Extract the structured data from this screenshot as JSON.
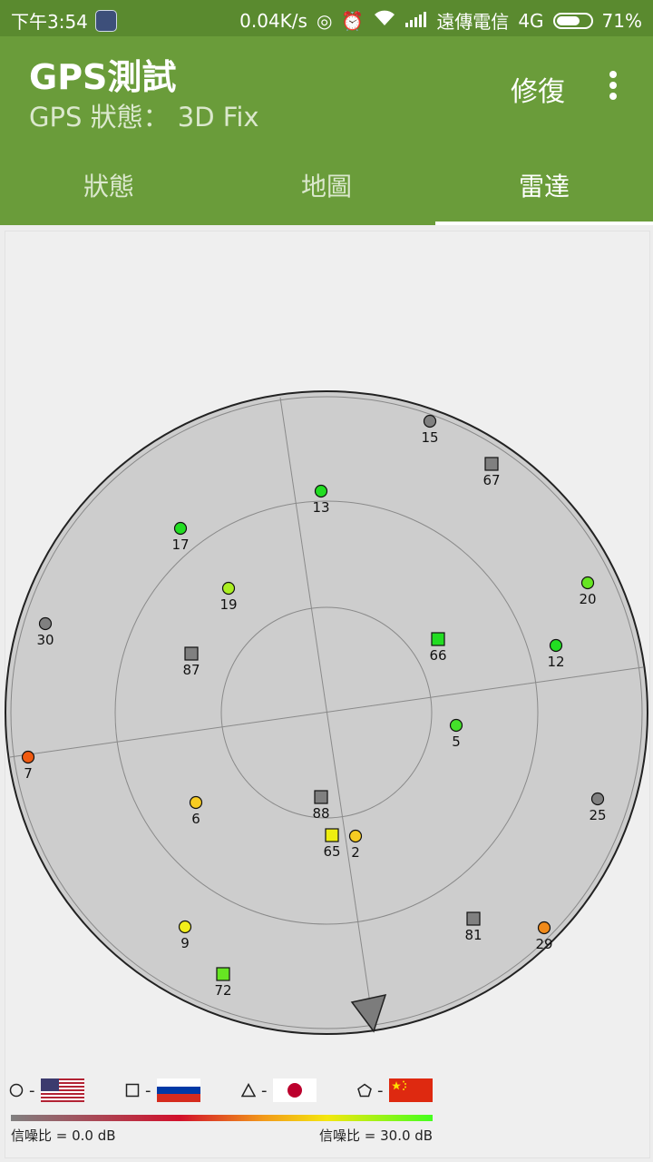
{
  "statusbar": {
    "time": "下午3:54",
    "speed": "0.04K/s",
    "carrier": "遠傳電信",
    "network": "4G",
    "battery": "71%",
    "battery_level": 0.71
  },
  "appbar": {
    "title": "GPS測試",
    "subtitle": "GPS 狀態： 3D Fix",
    "fix_button": "修復"
  },
  "tabs": [
    {
      "label": "狀態",
      "active": false
    },
    {
      "label": "地圖",
      "active": false
    },
    {
      "label": "雷達",
      "active": true
    }
  ],
  "satellites": [
    {
      "prn": "15",
      "shape": "circle",
      "color": "#808080"
    },
    {
      "prn": "67",
      "shape": "square",
      "color": "#808080"
    },
    {
      "prn": "13",
      "shape": "circle",
      "color": "#22dd22"
    },
    {
      "prn": "17",
      "shape": "circle",
      "color": "#22dd22"
    },
    {
      "prn": "20",
      "shape": "circle",
      "color": "#66e622"
    },
    {
      "prn": "19",
      "shape": "circle",
      "color": "#aaee22"
    },
    {
      "prn": "30",
      "shape": "circle",
      "color": "#808080"
    },
    {
      "prn": "66",
      "shape": "square",
      "color": "#22dd22"
    },
    {
      "prn": "12",
      "shape": "circle",
      "color": "#22dd22"
    },
    {
      "prn": "87",
      "shape": "square",
      "color": "#808080"
    },
    {
      "prn": "5",
      "shape": "circle",
      "color": "#44e02a"
    },
    {
      "prn": "7",
      "shape": "circle",
      "color": "#f05a10"
    },
    {
      "prn": "88",
      "shape": "square",
      "color": "#808080"
    },
    {
      "prn": "6",
      "shape": "circle",
      "color": "#f7cc22"
    },
    {
      "prn": "25",
      "shape": "circle",
      "color": "#808080"
    },
    {
      "prn": "65",
      "shape": "square",
      "color": "#eeee10"
    },
    {
      "prn": "2",
      "shape": "circle",
      "color": "#f7cc22"
    },
    {
      "prn": "9",
      "shape": "circle",
      "color": "#f2ee1a"
    },
    {
      "prn": "81",
      "shape": "square",
      "color": "#808080"
    },
    {
      "prn": "29",
      "shape": "circle",
      "color": "#f08a1a"
    },
    {
      "prn": "72",
      "shape": "square",
      "color": "#66e622"
    }
  ],
  "legend": {
    "items": [
      {
        "shape_icon": "circle-icon",
        "dash": "-",
        "flag": "usa-flag-icon"
      },
      {
        "shape_icon": "square-icon",
        "dash": "-",
        "flag": "russia-flag-icon"
      },
      {
        "shape_icon": "triangle-icon",
        "dash": "-",
        "flag": "japan-flag-icon"
      },
      {
        "shape_icon": "pentagon-icon",
        "dash": "-",
        "flag": "china-flag-icon"
      }
    ],
    "snr_min": "信噪比 = 0.0 dB",
    "snr_max": "信噪比 = 30.0 dB"
  }
}
